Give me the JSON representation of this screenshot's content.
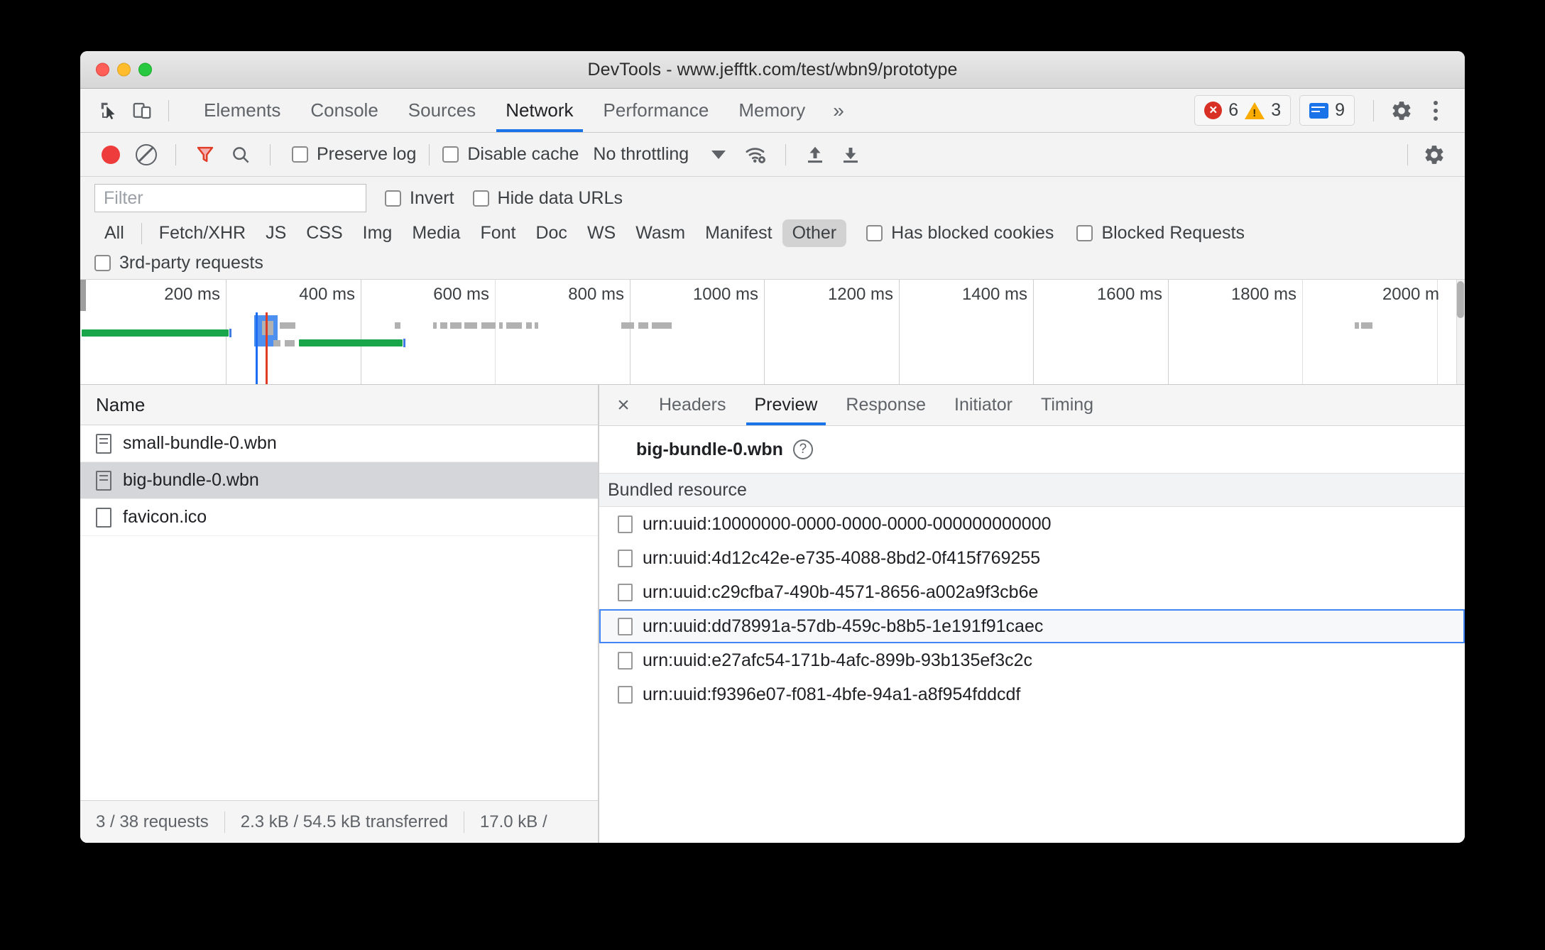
{
  "window": {
    "title": "DevTools - www.jefftk.com/test/wbn9/prototype",
    "traffic_lights": [
      "close",
      "minimize",
      "maximize"
    ]
  },
  "tabbar": {
    "inspect_icon": "inspect-cursor-icon",
    "device_icon": "device-toggle-icon",
    "tabs": [
      {
        "label": "Elements",
        "active": false
      },
      {
        "label": "Console",
        "active": false
      },
      {
        "label": "Sources",
        "active": false
      },
      {
        "label": "Network",
        "active": true
      },
      {
        "label": "Performance",
        "active": false
      },
      {
        "label": "Memory",
        "active": false
      }
    ],
    "more_tabs": "»",
    "error_count": "6",
    "warning_count": "3",
    "message_count": "9",
    "settings_icon": "gear-icon",
    "menu_icon": "kebab-menu-icon"
  },
  "net_toolbar": {
    "record_icon": "record-button-icon",
    "clear_icon": "clear-icon",
    "filter_icon": "filter-funnel-icon",
    "search_icon": "search-icon",
    "preserve_log_label": "Preserve log",
    "preserve_log_checked": false,
    "disable_cache_label": "Disable cache",
    "disable_cache_checked": false,
    "throttling_value": "No throttling",
    "network_conditions_icon": "wifi-gear-icon",
    "import_icon": "upload-har-icon",
    "export_icon": "download-har-icon",
    "settings_icon": "network-settings-gear-icon"
  },
  "filterbar": {
    "filter_placeholder": "Filter",
    "filter_value": "",
    "invert_label": "Invert",
    "invert_checked": false,
    "hide_data_urls_label": "Hide data URLs",
    "hide_data_urls_checked": false,
    "type_chips": [
      {
        "label": "All",
        "selected": false
      },
      {
        "label": "Fetch/XHR",
        "selected": false
      },
      {
        "label": "JS",
        "selected": false
      },
      {
        "label": "CSS",
        "selected": false
      },
      {
        "label": "Img",
        "selected": false
      },
      {
        "label": "Media",
        "selected": false
      },
      {
        "label": "Font",
        "selected": false
      },
      {
        "label": "Doc",
        "selected": false
      },
      {
        "label": "WS",
        "selected": false
      },
      {
        "label": "Wasm",
        "selected": false
      },
      {
        "label": "Manifest",
        "selected": false
      },
      {
        "label": "Other",
        "selected": true
      }
    ],
    "has_blocked_cookies_label": "Has blocked cookies",
    "has_blocked_cookies_checked": false,
    "blocked_requests_label": "Blocked Requests",
    "blocked_requests_checked": false,
    "third_party_label": "3rd-party requests",
    "third_party_checked": false
  },
  "overview": {
    "tick_labels": [
      "200 ms",
      "400 ms",
      "600 ms",
      "800 ms",
      "1000 ms",
      "1200 ms",
      "1400 ms",
      "1600 ms",
      "1800 ms",
      "2000 m"
    ],
    "dom_content_loaded_color": "#1b6ef3",
    "load_event_color": "#e03b24",
    "resource_color": "#19a64a"
  },
  "request_list": {
    "column_header": "Name",
    "rows": [
      {
        "name": "small-bundle-0.wbn",
        "icon": "wbn-document-icon",
        "selected": false
      },
      {
        "name": "big-bundle-0.wbn",
        "icon": "wbn-document-icon",
        "selected": true
      },
      {
        "name": "favicon.ico",
        "icon": "image-document-icon",
        "selected": false
      }
    ]
  },
  "statusbar": {
    "requests": "3 / 38 requests",
    "transferred": "2.3 kB / 54.5 kB transferred",
    "resources": "17.0 kB /"
  },
  "detail": {
    "close_icon": "close-icon",
    "tabs": [
      {
        "label": "Headers",
        "active": false
      },
      {
        "label": "Preview",
        "active": true
      },
      {
        "label": "Response",
        "active": false
      },
      {
        "label": "Initiator",
        "active": false
      },
      {
        "label": "Timing",
        "active": false
      }
    ],
    "preview_title": "big-bundle-0.wbn",
    "help_icon": "help-question-icon",
    "bundled_resource_header": "Bundled resource",
    "resources": [
      {
        "uuid": "urn:uuid:10000000-0000-0000-0000-000000000000",
        "selected": false
      },
      {
        "uuid": "urn:uuid:4d12c42e-e735-4088-8bd2-0f415f769255",
        "selected": false
      },
      {
        "uuid": "urn:uuid:c29cfba7-490b-4571-8656-a002a9f3cb6e",
        "selected": false
      },
      {
        "uuid": "urn:uuid:dd78991a-57db-459c-b8b5-1e191f91caec",
        "selected": true
      },
      {
        "uuid": "urn:uuid:e27afc54-171b-4afc-899b-93b135ef3c2c",
        "selected": false
      },
      {
        "uuid": "urn:uuid:f9396e07-f081-4bfe-94a1-a8f954fddcdf",
        "selected": false
      }
    ]
  },
  "colors": {
    "accent": "#1a73e8",
    "error": "#d93025",
    "warning": "#f9ab00",
    "resource_bar": "#19a64a"
  }
}
